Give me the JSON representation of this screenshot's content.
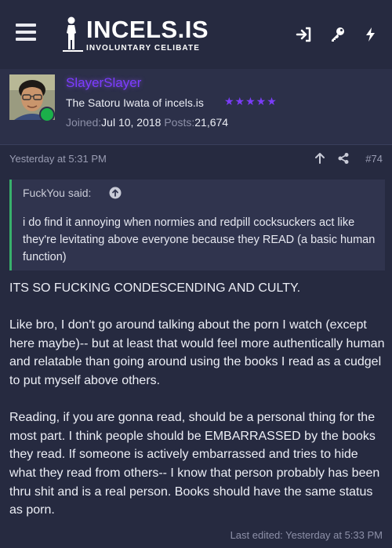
{
  "header": {
    "logo_title": "INCELS.IS",
    "logo_subtitle": "INVOLUNTARY CELIBATE",
    "icons": [
      "menu-icon",
      "login-icon",
      "key-icon",
      "lightning-icon"
    ]
  },
  "user": {
    "name": "SlayerSlayer",
    "title": "The Satoru Iwata of incels.is",
    "stars": "★★★★★",
    "joined_label": "Joined:",
    "joined_value": "Jul 10, 2018",
    "posts_label": "Posts:",
    "posts_value": "21,674",
    "online": true,
    "name_color": "#7c3cff"
  },
  "post": {
    "date": "Yesterday at 5:31 PM",
    "number": "#74",
    "icons": [
      "arrow-up-icon",
      "share-icon"
    ]
  },
  "quote": {
    "author_said": "FuckYou said:",
    "text": "i do find it annoying when normies and redpill cocksuckers act like they're levitating above everyone because they READ (a basic human function)",
    "accent": "#38b06c"
  },
  "body": {
    "p1": "ITS SO FUCKING CONDESCENDING AND CULTY.",
    "p2": "Like bro, I don't go around talking about the porn I watch (except here maybe)-- but at least that would feel more authentically human and relatable than going around using the books I read as a cudgel to put myself above others.",
    "p3": "Reading, if you are gonna read, should be a personal thing for the most part. I think people should be EMBARRASSED by the books they read. If someone is actively embarrassed and tries to hide what they read from others-- I know that person probably has been thru shit and is a real person. Books should have the same status as porn."
  },
  "last_edited": "Last edited: Yesterday at 5:33 PM"
}
